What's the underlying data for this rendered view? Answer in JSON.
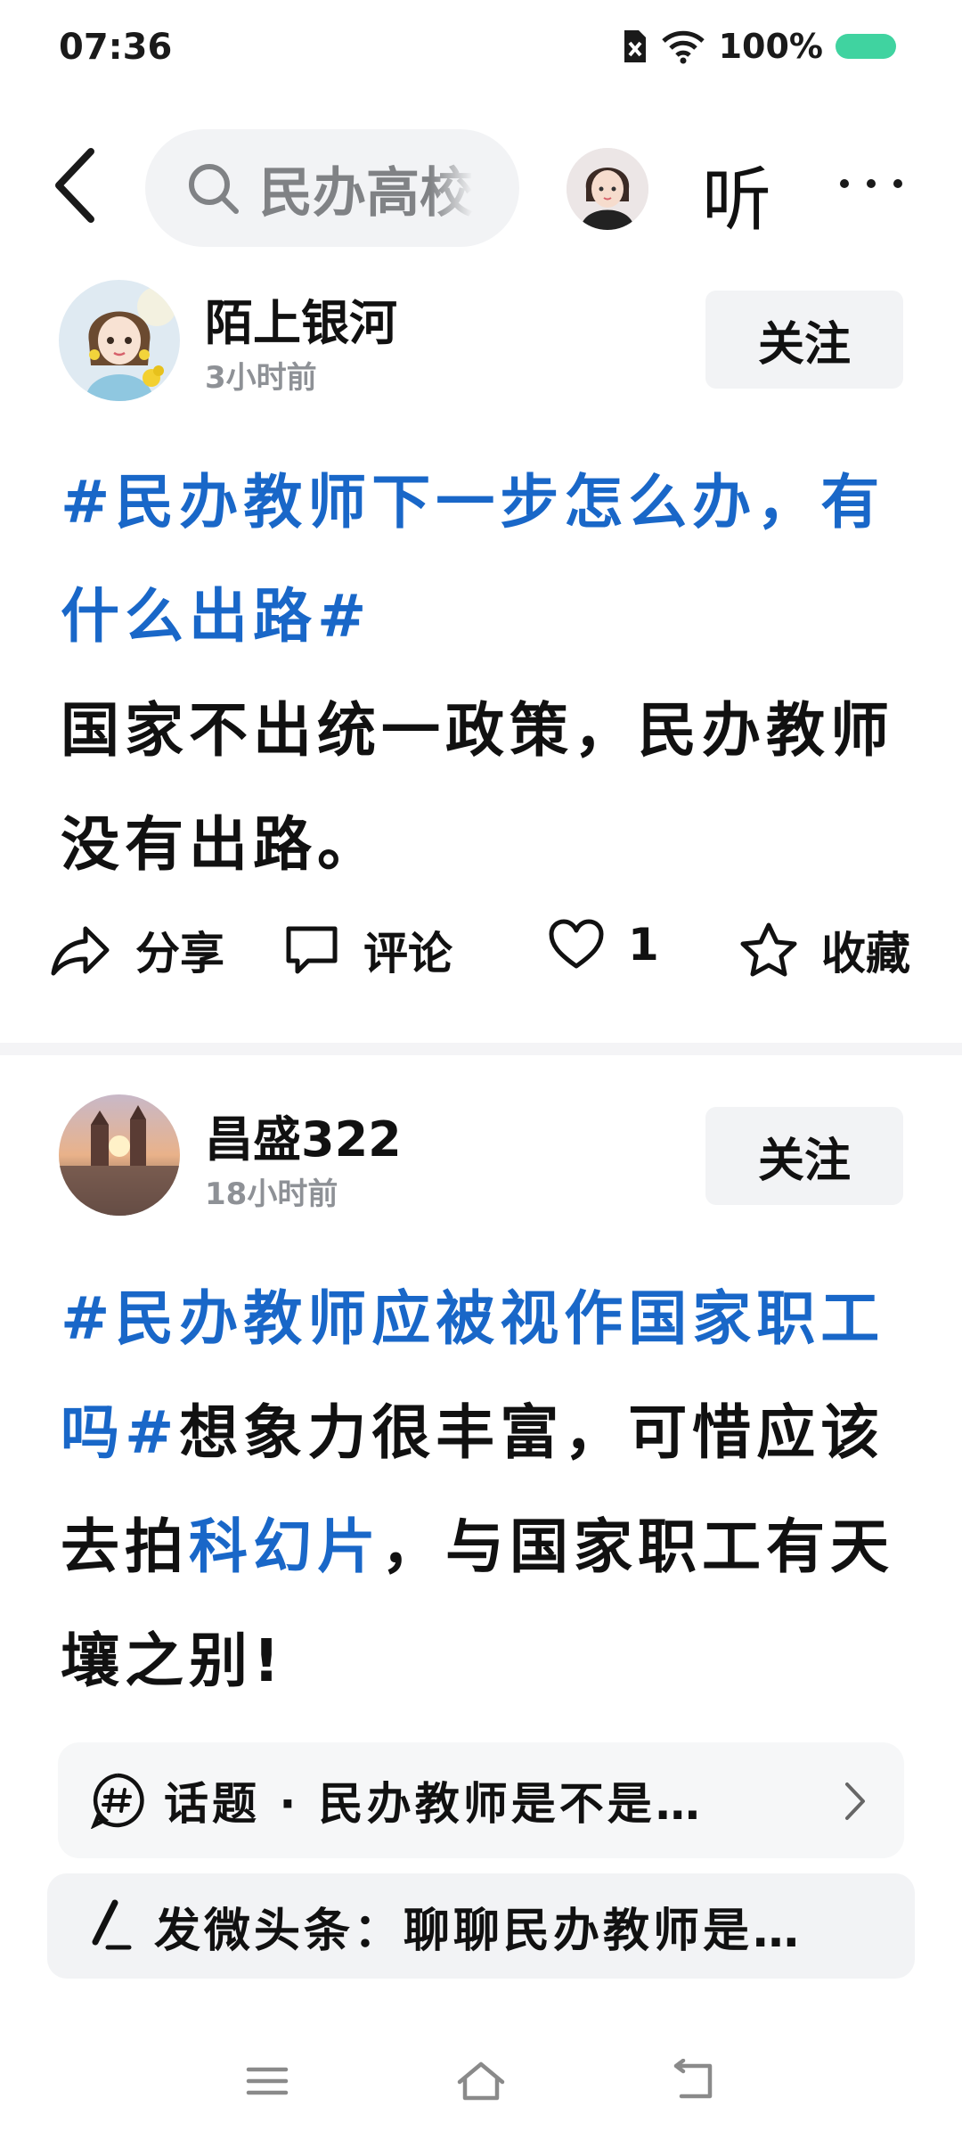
{
  "status_bar": {
    "time": "07:36",
    "battery": "100%"
  },
  "header": {
    "search_text": "民办高校",
    "listen_label": "听"
  },
  "posts": [
    {
      "author": "陌上银河",
      "time": "3小时前",
      "follow_label": "关注",
      "tag": "#民办教师下一步怎么办，有什么出路#",
      "body": "国家不出统一政策，民办教师没有出路。",
      "actions": {
        "share": "分享",
        "comment": "评论",
        "likes": "1",
        "favorite": "收藏"
      }
    },
    {
      "author": "昌盛322",
      "time": "18小时前",
      "follow_label": "关注",
      "tag": "#民办教师应被视作国家职工吗#",
      "body_1": "想象力很丰富，可惜应该去拍",
      "body_link": "科幻片",
      "body_2": "，与国家职工有天壤之别!"
    }
  ],
  "topic_bar": {
    "label": "话题 · 民办教师是不是…"
  },
  "compose_bar": {
    "label": "发微头条：聊聊民办教师是…"
  },
  "colors": {
    "tag_blue": "#1967c8",
    "battery_green": "#40d3a0"
  }
}
